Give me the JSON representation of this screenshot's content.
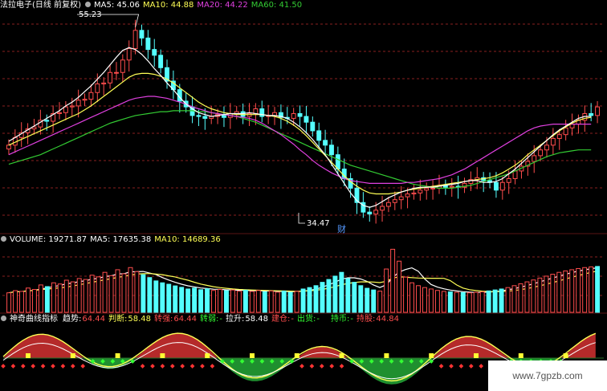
{
  "price_header": {
    "title": "法拉电子(日线 前复权)",
    "ma5": "MA5: 45.06",
    "ma10": "MA10: 44.88",
    "ma20": "MA20: 44.22",
    "ma60": "MA60: 41.50"
  },
  "annotations": {
    "high": "55.23",
    "low": "34.47",
    "fin_marker": "财"
  },
  "volume_header": {
    "volume": "VOLUME: 19271.87",
    "ma5": "MA5: 17635.38",
    "ma10": "MA10: 14689.36"
  },
  "indicator_header": {
    "name": "神奇曲线指标",
    "trend_label": "趋势:",
    "trend_value": "64.44",
    "judge_label": "判断:",
    "judge_value": "58.48",
    "strong_label": "转强:",
    "strong_value": "64.44",
    "weak_label": "转弱:",
    "weak_value": "-",
    "pull_label": "拉升:",
    "pull_value": "58.48",
    "build_label": "建仓:",
    "build_value": "-",
    "ship_label": "出货:",
    "ship_value": "-",
    "hold_label": "持币:",
    "hold_value": "-",
    "holdshare_label": "持股:",
    "holdshare_value": "44.84"
  },
  "watermark": "www.7gpzb.com",
  "colors": {
    "up": "#ff4d4d",
    "down": "#54ffff",
    "ma5": "#ffffff",
    "ma10": "#ffff55",
    "ma20": "#e040e0",
    "ma60": "#33cc33",
    "grid": "#8a1f1f"
  },
  "chart_data": [
    {
      "type": "candlestick",
      "title": "法拉电子(日线 前复权)",
      "xlabel": "",
      "ylabel": "",
      "annotations": [
        {
          "label": "55.23",
          "kind": "high"
        },
        {
          "label": "34.47",
          "kind": "low"
        }
      ],
      "close": [
        42.0,
        42.8,
        43.3,
        43.7,
        43.9,
        44.6,
        44.5,
        45.3,
        45.4,
        46.0,
        46.1,
        46.7,
        46.8,
        47.5,
        48.4,
        48.5,
        49.6,
        49.6,
        50.9,
        52.1,
        54.0,
        53.2,
        52.0,
        51.4,
        50.1,
        48.7,
        47.8,
        46.6,
        46.0,
        45.1,
        45.0,
        44.8,
        45.0,
        45.2,
        44.9,
        45.3,
        45.5,
        45.0,
        45.3,
        45.8,
        45.0,
        45.1,
        45.4,
        44.9,
        44.8,
        45.3,
        45.0,
        44.4,
        43.5,
        42.5,
        42.0,
        41.0,
        39.5,
        38.5,
        37.5,
        36.0,
        35.0,
        34.8,
        35.2,
        35.6,
        36.0,
        36.3,
        36.6,
        36.9,
        37.0,
        37.3,
        37.5,
        37.5,
        37.8,
        37.6,
        37.7,
        37.6,
        38.0,
        38.4,
        38.6,
        38.3,
        38.1,
        37.3,
        38.1,
        38.5,
        39.3,
        39.8,
        40.3,
        40.9,
        41.5,
        42.0,
        42.7,
        43.1,
        43.8,
        44.2,
        44.6,
        45.3,
        45.1,
        46.0
      ],
      "ma5": [
        42.4,
        42.8,
        43.2,
        43.6,
        44.0,
        44.4,
        44.8,
        45.2,
        45.6,
        46.1,
        46.5,
        47.0,
        47.6,
        48.2,
        48.9,
        49.6,
        50.4,
        51.2,
        51.9,
        52.2,
        52.0,
        51.5,
        50.8,
        50.0,
        49.3,
        48.5,
        47.8,
        47.0,
        46.3,
        45.8,
        45.4,
        45.2,
        45.0,
        45.1,
        45.2,
        45.3,
        45.3,
        45.3,
        45.4,
        45.3,
        45.2,
        45.1,
        45.1,
        45.0,
        44.8,
        44.4,
        43.9,
        43.3,
        42.6,
        41.8,
        41.0,
        40.0,
        39.0,
        38.0,
        37.0,
        36.2,
        35.7,
        35.5,
        35.7,
        36.1,
        36.5,
        36.8,
        37.1,
        37.3,
        37.5,
        37.6,
        37.6,
        37.6,
        37.7,
        37.8,
        37.9,
        38.0,
        38.2,
        38.3,
        38.3,
        38.1,
        38.1,
        38.2,
        38.5,
        39.0,
        39.5,
        40.1,
        40.7,
        41.3,
        41.9,
        42.5,
        43.1,
        43.6,
        44.0,
        44.4,
        44.8,
        45.0,
        45.0
      ],
      "ma10": [
        42.0,
        42.3,
        42.6,
        42.9,
        43.2,
        43.5,
        43.8,
        44.1,
        44.4,
        44.7,
        45.0,
        45.3,
        45.7,
        46.1,
        46.6,
        47.1,
        47.6,
        48.1,
        48.6,
        49.1,
        49.4,
        49.5,
        49.5,
        49.4,
        49.2,
        48.9,
        48.5,
        48.0,
        47.5,
        47.0,
        46.5,
        46.1,
        45.8,
        45.6,
        45.4,
        45.3,
        45.2,
        45.2,
        45.2,
        45.2,
        45.2,
        45.1,
        45.0,
        44.8,
        44.5,
        44.1,
        43.6,
        43.0,
        42.3,
        41.6,
        40.9,
        40.2,
        39.5,
        38.8,
        38.2,
        37.7,
        37.3,
        37.0,
        36.9,
        36.9,
        36.9,
        37.0,
        37.1,
        37.3,
        37.4,
        37.5,
        37.6,
        37.7,
        37.8,
        37.9,
        38.0,
        38.1,
        38.2,
        38.3,
        38.4,
        38.5,
        38.6,
        38.8,
        39.1,
        39.5,
        39.9,
        40.4,
        41.0,
        41.5,
        42.0,
        42.5,
        43.0,
        43.5,
        43.9,
        44.3,
        44.6,
        44.8,
        44.9
      ],
      "ma20": [
        41.0,
        41.3,
        41.6,
        41.9,
        42.2,
        42.5,
        42.8,
        43.1,
        43.4,
        43.7,
        44.0,
        44.3,
        44.6,
        44.9,
        45.2,
        45.5,
        45.8,
        46.1,
        46.4,
        46.7,
        46.9,
        47.0,
        47.1,
        47.1,
        47.0,
        46.9,
        46.7,
        46.5,
        46.3,
        46.0,
        45.8,
        45.6,
        45.4,
        45.3,
        45.2,
        45.1,
        45.0,
        44.9,
        44.8,
        44.6,
        44.3,
        43.9,
        43.5,
        43.1,
        42.6,
        42.1,
        41.5,
        41.0,
        40.4,
        39.9,
        39.5,
        39.1,
        38.8,
        38.5,
        38.3,
        38.2,
        38.1,
        38.0,
        38.0,
        38.0,
        38.0,
        38.0,
        38.0,
        38.1,
        38.1,
        38.2,
        38.3,
        38.4,
        38.5,
        38.7,
        38.9,
        39.2,
        39.5,
        39.9,
        40.3,
        40.7,
        41.1,
        41.5,
        41.9,
        42.3,
        42.7,
        43.1,
        43.5,
        43.8,
        44.0,
        44.1,
        44.2,
        44.2,
        44.2,
        44.2,
        44.2,
        44.2,
        44.2
      ],
      "ma60": [
        40.0,
        40.2,
        40.4,
        40.6,
        40.8,
        41.0,
        41.3,
        41.6,
        41.9,
        42.2,
        42.5,
        42.8,
        43.1,
        43.4,
        43.7,
        44.0,
        44.3,
        44.5,
        44.7,
        44.9,
        45.1,
        45.2,
        45.3,
        45.4,
        45.5,
        45.5,
        45.6,
        45.6,
        45.6,
        45.6,
        45.5,
        45.5,
        45.4,
        45.3,
        45.2,
        45.1,
        45.0,
        44.8,
        44.6,
        44.4,
        44.1,
        43.8,
        43.5,
        43.2,
        42.9,
        42.6,
        42.3,
        42.0,
        41.7,
        41.4,
        41.1,
        40.8,
        40.5,
        40.2,
        39.9,
        39.7,
        39.5,
        39.3,
        39.1,
        38.9,
        38.7,
        38.5,
        38.3,
        38.1,
        37.9,
        37.8,
        37.7,
        37.6,
        37.5,
        37.5,
        37.5,
        37.6,
        37.7,
        37.8,
        38.0,
        38.2,
        38.4,
        38.6,
        38.8,
        39.0,
        39.3,
        39.6,
        39.9,
        40.2,
        40.5,
        40.8,
        41.0,
        41.2,
        41.3,
        41.4,
        41.5,
        41.5,
        41.5
      ],
      "ylim": [
        33.0,
        56.0
      ],
      "grid": true
    },
    {
      "type": "bar",
      "title": "VOLUME",
      "values": [
        8200,
        9100,
        8800,
        10200,
        9600,
        11500,
        10800,
        12400,
        11900,
        13500,
        12800,
        14200,
        13800,
        15600,
        14900,
        16800,
        15400,
        17900,
        16200,
        18800,
        17100,
        15800,
        14600,
        13200,
        12400,
        11800,
        11100,
        10500,
        9800,
        10200,
        9500,
        9900,
        9200,
        9600,
        9100,
        9400,
        8900,
        9300,
        8800,
        9200,
        8600,
        9000,
        8500,
        8900,
        8400,
        8800,
        9800,
        10400,
        11200,
        12600,
        13800,
        15200,
        16800,
        14200,
        12600,
        11200,
        10100,
        9400,
        8900,
        18200,
        26500,
        21500,
        14800,
        12400,
        11200,
        10400,
        9800,
        9200,
        8800,
        8600,
        8400,
        8300,
        8200,
        8400,
        8600,
        9000,
        9400,
        9800,
        10400,
        11200,
        12000,
        12800,
        13600,
        14400,
        15200,
        16000,
        16800,
        17400,
        17900,
        18400,
        18800,
        19100,
        19271
      ],
      "ylim": [
        0,
        28000
      ],
      "grid": true
    }
  ]
}
